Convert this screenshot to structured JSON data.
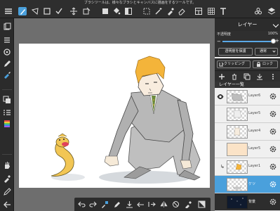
{
  "notice": "ブラシツールは、様々なブラシとキャンバスに描画をするツールです。",
  "panel": {
    "title": "レイヤー",
    "opacity_label": "不透明度",
    "opacity_value": "100%",
    "opacity_level": 1.0,
    "protect_alpha_label": "透明度を保護",
    "blend_mode_label": "通常",
    "clipping_label": "クリッピング",
    "lock_label": "ロック",
    "list_header": "レイヤー一覧"
  },
  "layers": [
    {
      "name": "Layer6",
      "visible": true,
      "selected": false,
      "thumb": "checker"
    },
    {
      "name": "Layer5",
      "visible": false,
      "selected": false,
      "thumb": "checker"
    },
    {
      "name": "Layer4",
      "visible": false,
      "selected": false,
      "thumb": "checker"
    },
    {
      "name": "Layer5",
      "visible": false,
      "selected": false,
      "thumb": "peach"
    },
    {
      "name": "Layer1",
      "visible": false,
      "selected": false,
      "thumb": "checker",
      "clipped": true
    },
    {
      "name": "ケツ",
      "visible": false,
      "selected": true,
      "thumb": "checker"
    },
    {
      "name": "背景",
      "visible": false,
      "selected": false,
      "thumb": "night"
    }
  ],
  "colors": {
    "toolbar_bg": "#2e2e2e",
    "canvas_area": "#6e6e6e",
    "accent_blue": "#4aa0dc",
    "hair_yellow": "#f4b43a",
    "suit_gray": "#b8b8b8"
  },
  "icons": {
    "top_toolbar": [
      "menu-icon",
      "brush-icon",
      "selection-rect-icon",
      "check-icon",
      "transform-icon",
      "fill-icon",
      "gradient-icon",
      "magic-wand-icon",
      "marquee-icon",
      "eyedropper-icon",
      "eraser-icon",
      "layout-icon",
      "grid-icon",
      "text-icon",
      "materials-icon",
      "layers-icon"
    ],
    "left_toolbar": [
      "layers-icon",
      "navigator-icon",
      "rotate-icon",
      "pen-icon",
      "brush-settings-icon",
      "color-icon",
      "palette-icon",
      "hand-icon",
      "eyedropper-icon",
      "undo-icon"
    ],
    "bottom_toolbar": [
      "undo-icon",
      "redo-icon",
      "color-swap-icon",
      "pen-icon",
      "save-icon",
      "undo2-icon",
      "export-icon",
      "flip-icon",
      "no-touch-icon",
      "color-picker-icon",
      "panel-icon"
    ]
  }
}
